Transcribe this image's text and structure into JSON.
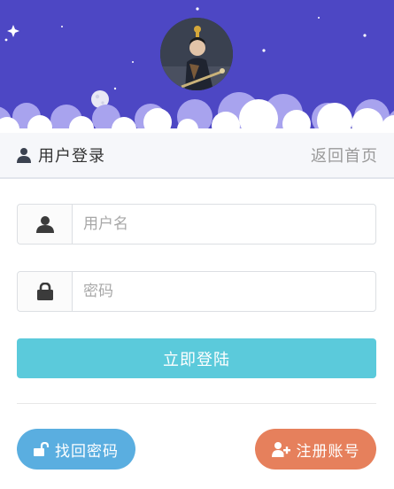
{
  "header": {
    "title": "用户登录",
    "back_home": "返回首页"
  },
  "form": {
    "username_placeholder": "用户名",
    "password_placeholder": "密码"
  },
  "actions": {
    "login_label": "立即登陆",
    "find_password_label": "找回密码",
    "register_label": "注册账号"
  },
  "colors": {
    "banner": "#4d47c4",
    "login_button": "#5bcadb",
    "find_password_button": "#5aaee0",
    "register_button": "#e6805c"
  }
}
